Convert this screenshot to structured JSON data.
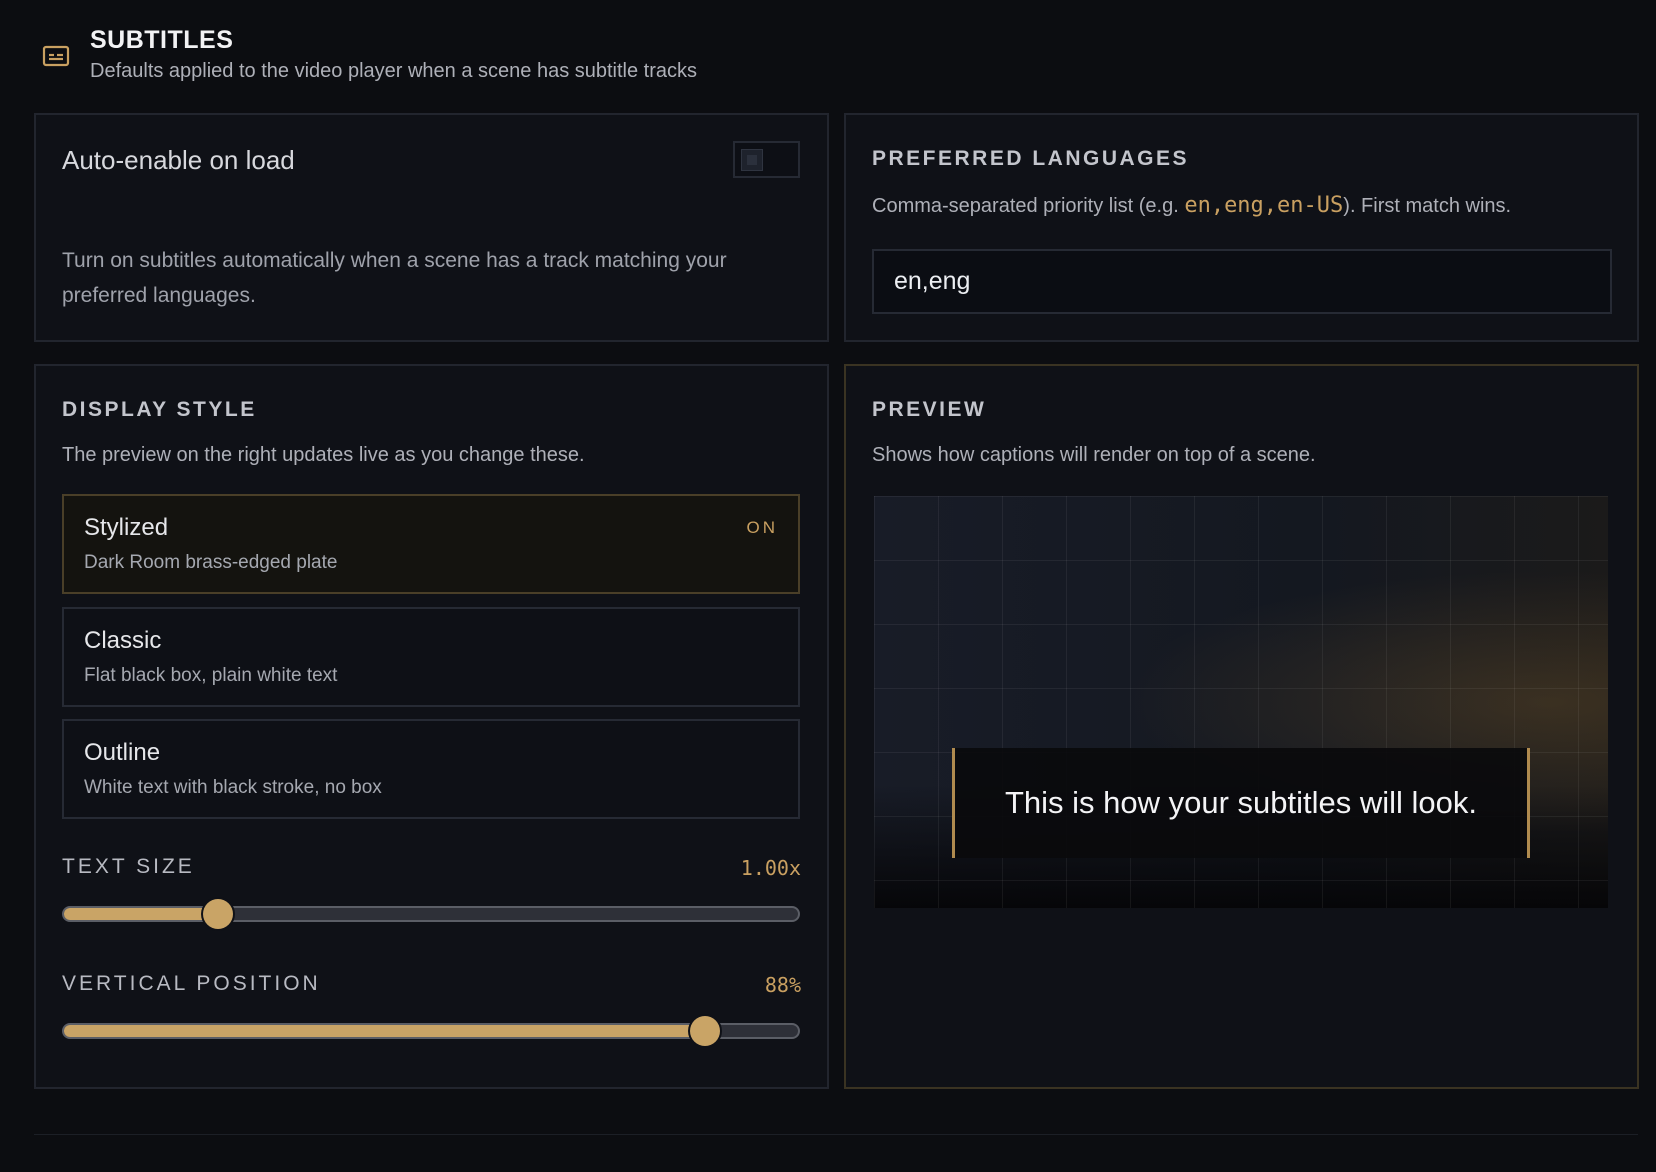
{
  "header": {
    "icon": "subtitles-icon",
    "title": "SUBTITLES",
    "subtitle": "Defaults applied to the video player when a scene has subtitle tracks"
  },
  "auto_enable": {
    "label": "Auto-enable on load",
    "enabled": false,
    "description": "Turn on subtitles automatically when a scene has a track matching your preferred languages."
  },
  "languages": {
    "title": "PREFERRED LANGUAGES",
    "desc_before": "Comma-separated priority list (e.g. ",
    "desc_example": "en,eng,en-US",
    "desc_after": "). First match wins.",
    "value": "en,eng"
  },
  "display_style": {
    "title": "DISPLAY STYLE",
    "description": "The preview on the right updates live as you change these.",
    "options": [
      {
        "name": "Stylized",
        "desc": "Dark Room brass-edged plate",
        "badge": "ON"
      },
      {
        "name": "Classic",
        "desc": "Flat black box, plain white text"
      },
      {
        "name": "Outline",
        "desc": "White text with black stroke, no box"
      }
    ],
    "text_size": {
      "label": "TEXT SIZE",
      "value_text": "1.00x",
      "fraction": 0.21
    },
    "vertical_position": {
      "label": "VERTICAL POSITION",
      "value_text": "88%",
      "fraction": 0.873
    }
  },
  "preview": {
    "title": "PREVIEW",
    "description": "Shows how captions will render on top of a scene.",
    "caption": "This is how your subtitles will look."
  },
  "colors": {
    "accent": "#c9a466",
    "background": "#0c0d11",
    "card": "#0f1117"
  }
}
